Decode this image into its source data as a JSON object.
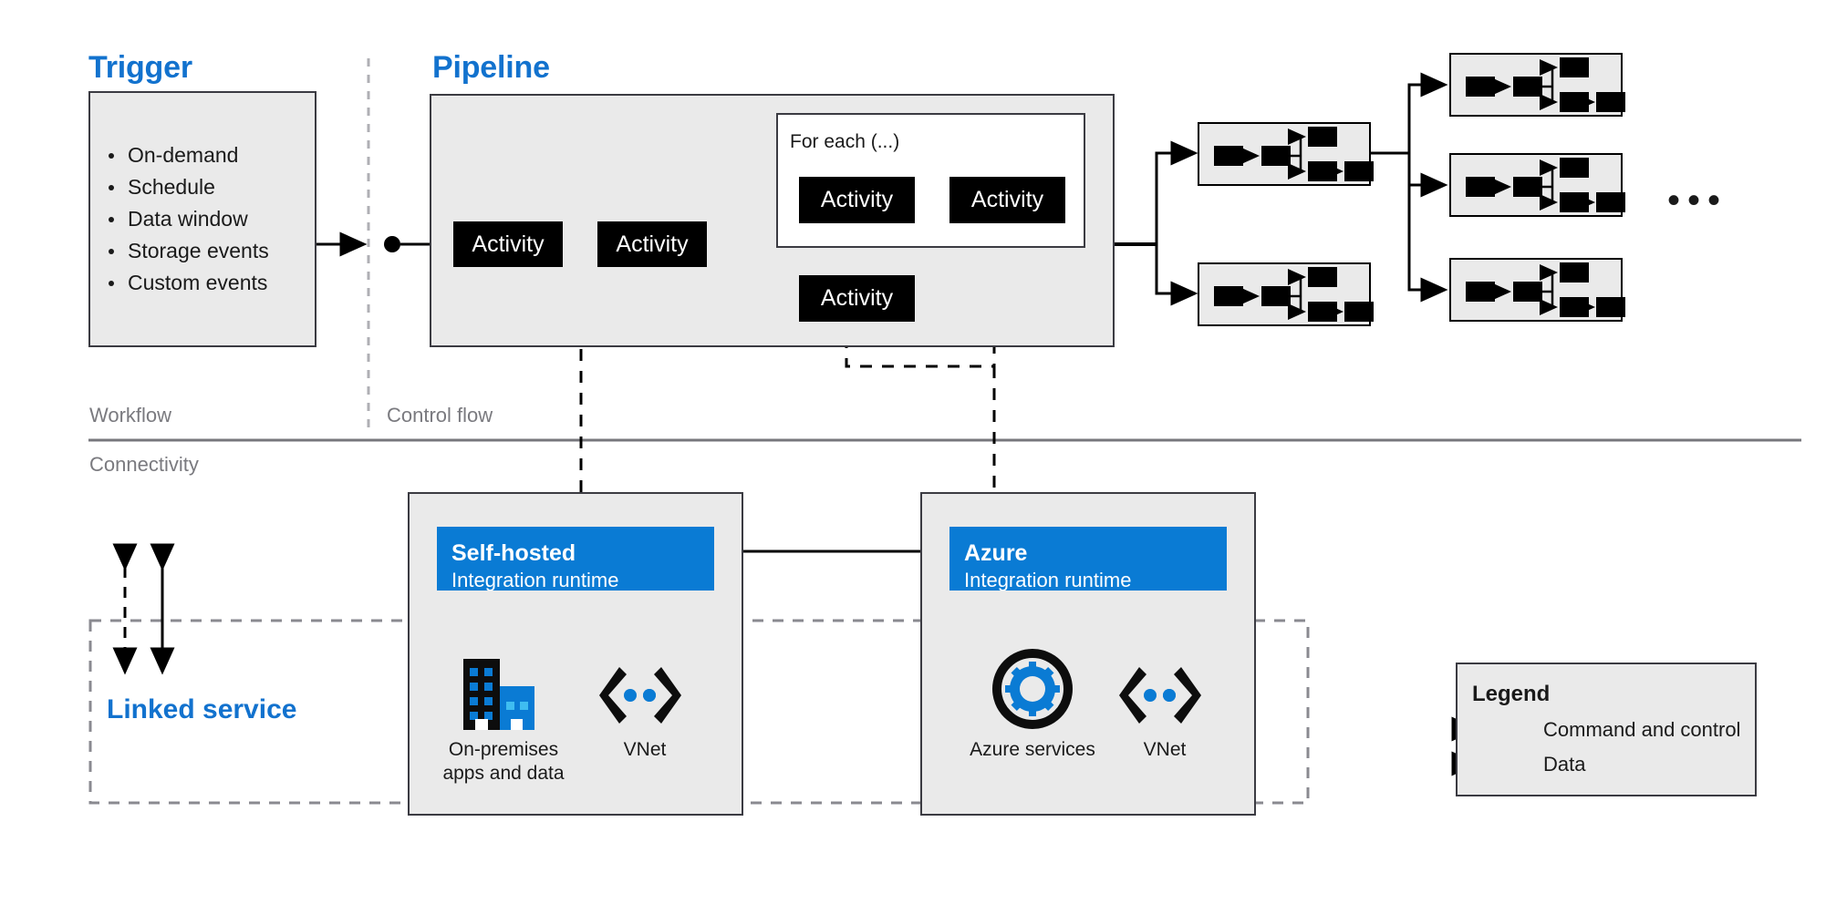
{
  "diagram": {
    "title_trigger": "Trigger",
    "title_pipeline": "Pipeline",
    "title_linked_service": "Linked service"
  },
  "trigger": {
    "label": "Trigger",
    "items": [
      "On-demand",
      "Schedule",
      "Data window",
      "Storage events",
      "Custom events"
    ]
  },
  "pipeline": {
    "label": "Pipeline",
    "activity_label": "Activity",
    "foreach_label": "For each (...)",
    "activities": [
      {
        "name": "activity-1",
        "label": "Activity"
      },
      {
        "name": "activity-2",
        "label": "Activity"
      },
      {
        "name": "activity-foreach-1",
        "label": "Activity"
      },
      {
        "name": "activity-foreach-2",
        "label": "Activity"
      },
      {
        "name": "activity-branch-lower",
        "label": "Activity"
      }
    ]
  },
  "sub_pipelines": {
    "count_visible": 5,
    "ellipsis": "•••"
  },
  "zones": {
    "workflow": "Workflow",
    "control_flow": "Control flow",
    "connectivity": "Connectivity"
  },
  "self_hosted_ir": {
    "title": "Self-hosted",
    "subtitle": "Integration runtime",
    "icons": [
      {
        "name": "on-premises-icon",
        "caption_line1": "On-premises",
        "caption_line2": "apps and data"
      },
      {
        "name": "vnet-icon",
        "caption_line1": "VNet",
        "caption_line2": ""
      }
    ]
  },
  "azure_ir": {
    "title": "Azure",
    "subtitle": "Integration runtime",
    "icons": [
      {
        "name": "azure-services-icon",
        "caption_line1": "Azure services",
        "caption_line2": ""
      },
      {
        "name": "vnet-icon",
        "caption_line1": "VNet",
        "caption_line2": ""
      }
    ]
  },
  "legend": {
    "title": "Legend",
    "entries": [
      {
        "name": "command-and-control",
        "label": "Command and control",
        "style": "dashed-double-arrow"
      },
      {
        "name": "data",
        "label": "Data",
        "style": "solid-double-arrow"
      }
    ]
  },
  "colors": {
    "accent_blue": "#0A7BD4",
    "title_blue": "#1272CE",
    "panel_grey": "#EAEAEA",
    "border_dark": "#3B3B42",
    "activity_black": "#000000",
    "zone_label_grey": "#7A7A7F"
  }
}
